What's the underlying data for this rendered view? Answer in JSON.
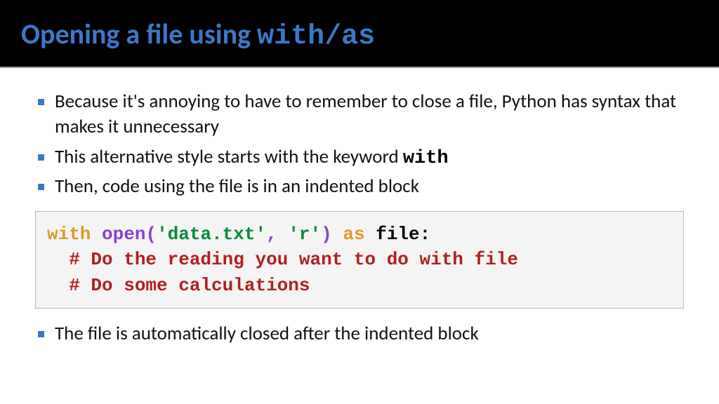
{
  "header": {
    "title_pre": "Opening a file using ",
    "title_mono": "with/as"
  },
  "bullets_top": [
    {
      "text": "Because it's annoying to have to remember to close a file, Python has syntax that makes it unnecessary",
      "mono_suffix": ""
    },
    {
      "text": "This alternative style starts with the keyword ",
      "mono_suffix": "with"
    },
    {
      "text": "Then, code using the file is in an indented block",
      "mono_suffix": ""
    }
  ],
  "code": {
    "with": "with",
    "open": "open",
    "lparen": "(",
    "arg1": "'data.txt'",
    "comma": ",",
    "arg2": "'r'",
    "rparen": ")",
    "as": "as",
    "var": "file:",
    "comment1": "# Do the reading you want to do with file",
    "comment2": "# Do some calculations"
  },
  "bullets_bottom": [
    {
      "text": "The file is automatically closed after the indented block",
      "mono_suffix": ""
    }
  ]
}
